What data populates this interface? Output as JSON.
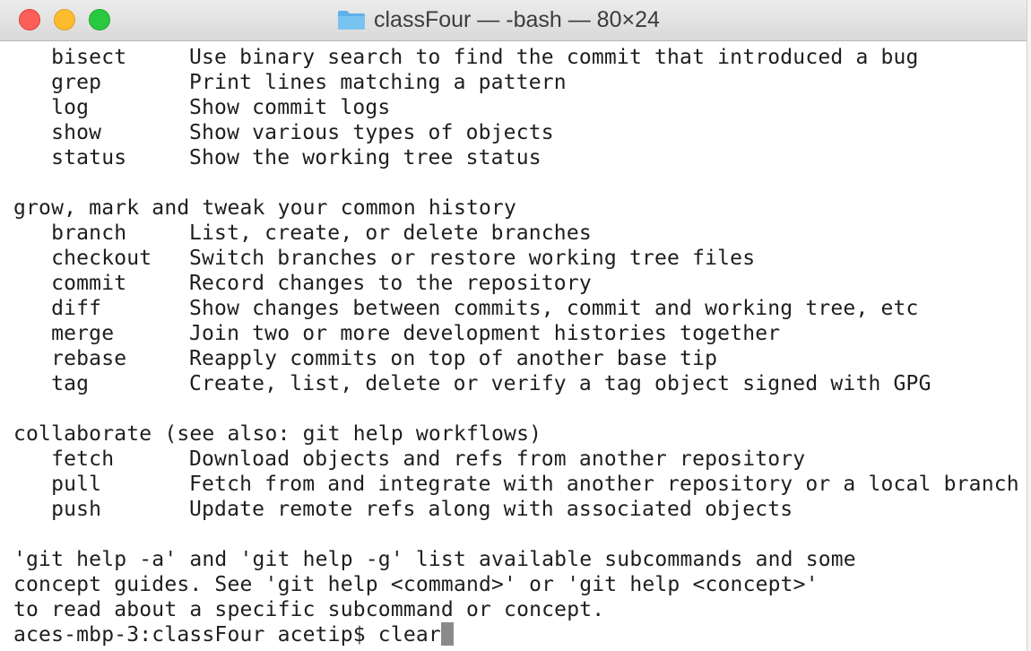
{
  "window": {
    "title": "classFour — -bash — 80×24"
  },
  "terminal": {
    "lines": [
      {
        "cmd": "   bisect",
        "desc": "Use binary search to find the commit that introduced a bug"
      },
      {
        "cmd": "   grep",
        "desc": "Print lines matching a pattern"
      },
      {
        "cmd": "   log",
        "desc": "Show commit logs"
      },
      {
        "cmd": "   show",
        "desc": "Show various types of objects"
      },
      {
        "cmd": "   status",
        "desc": "Show the working tree status"
      },
      {
        "text": ""
      },
      {
        "text": "grow, mark and tweak your common history"
      },
      {
        "cmd": "   branch",
        "desc": "List, create, or delete branches"
      },
      {
        "cmd": "   checkout",
        "desc": "Switch branches or restore working tree files"
      },
      {
        "cmd": "   commit",
        "desc": "Record changes to the repository"
      },
      {
        "cmd": "   diff",
        "desc": "Show changes between commits, commit and working tree, etc"
      },
      {
        "cmd": "   merge",
        "desc": "Join two or more development histories together"
      },
      {
        "cmd": "   rebase",
        "desc": "Reapply commits on top of another base tip"
      },
      {
        "cmd": "   tag",
        "desc": "Create, list, delete or verify a tag object signed with GPG"
      },
      {
        "text": ""
      },
      {
        "text": "collaborate (see also: git help workflows)"
      },
      {
        "cmd": "   fetch",
        "desc": "Download objects and refs from another repository"
      },
      {
        "cmd": "   pull",
        "desc": "Fetch from and integrate with another repository or a local branch"
      },
      {
        "cmd": "   push",
        "desc": "Update remote refs along with associated objects"
      },
      {
        "text": ""
      },
      {
        "text": "'git help -a' and 'git help -g' list available subcommands and some"
      },
      {
        "text": "concept guides. See 'git help <command>' or 'git help <concept>'"
      },
      {
        "text": "to read about a specific subcommand or concept."
      }
    ],
    "prompt": "aces-mbp-3:classFour acetip$ ",
    "input": "clear"
  }
}
